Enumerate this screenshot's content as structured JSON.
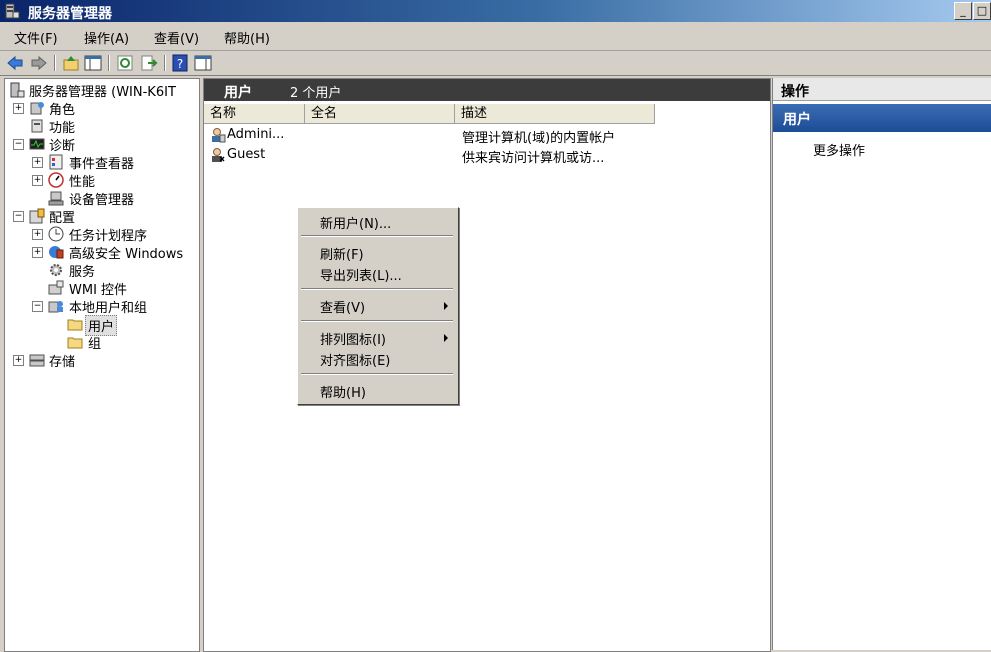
{
  "window": {
    "title": "服务器管理器",
    "min_label": "_",
    "max_label": "□"
  },
  "menubar": [
    "文件(F)",
    "操作(A)",
    "查看(V)",
    "帮助(H)"
  ],
  "toolbar": [
    "back-icon",
    "forward-icon",
    "up-icon",
    "show-hide-tree-icon",
    "refresh-icon",
    "export-icon",
    "help-icon",
    "show-hide-action-pane-icon"
  ],
  "tree": {
    "root": "服务器管理器 (WIN-K6IT",
    "items": {
      "roles": "角色",
      "features": "功能",
      "diagnostics": "诊断",
      "event_viewer": "事件查看器",
      "performance": "性能",
      "device_manager": "设备管理器",
      "configuration": "配置",
      "task_scheduler": "任务计划程序",
      "firewall": "高级安全 Windows",
      "services": "服务",
      "wmi": "WMI 控件",
      "local_users_groups": "本地用户和组",
      "users": "用户",
      "groups": "组",
      "storage": "存储"
    },
    "expanders": {
      "plus": "+",
      "minus": "−"
    }
  },
  "main": {
    "header_title": "用户",
    "header_count": "2 个用户",
    "columns": [
      "名称",
      "全名",
      "描述"
    ],
    "rows": [
      {
        "name": "Admini...",
        "fullname": "",
        "description": "管理计算机(域)的内置帐户"
      },
      {
        "name": "Guest",
        "fullname": "",
        "description": "供来宾访问计算机或访..."
      }
    ]
  },
  "actions": {
    "title": "操作",
    "section": "用户",
    "more": "更多操作"
  },
  "context_menu": {
    "new_user": "新用户(N)...",
    "refresh": "刷新(F)",
    "export_list": "导出列表(L)...",
    "view": "查看(V)",
    "arrange_icons": "排列图标(I)",
    "line_up_icons": "对齐图标(E)",
    "help": "帮助(H)"
  }
}
